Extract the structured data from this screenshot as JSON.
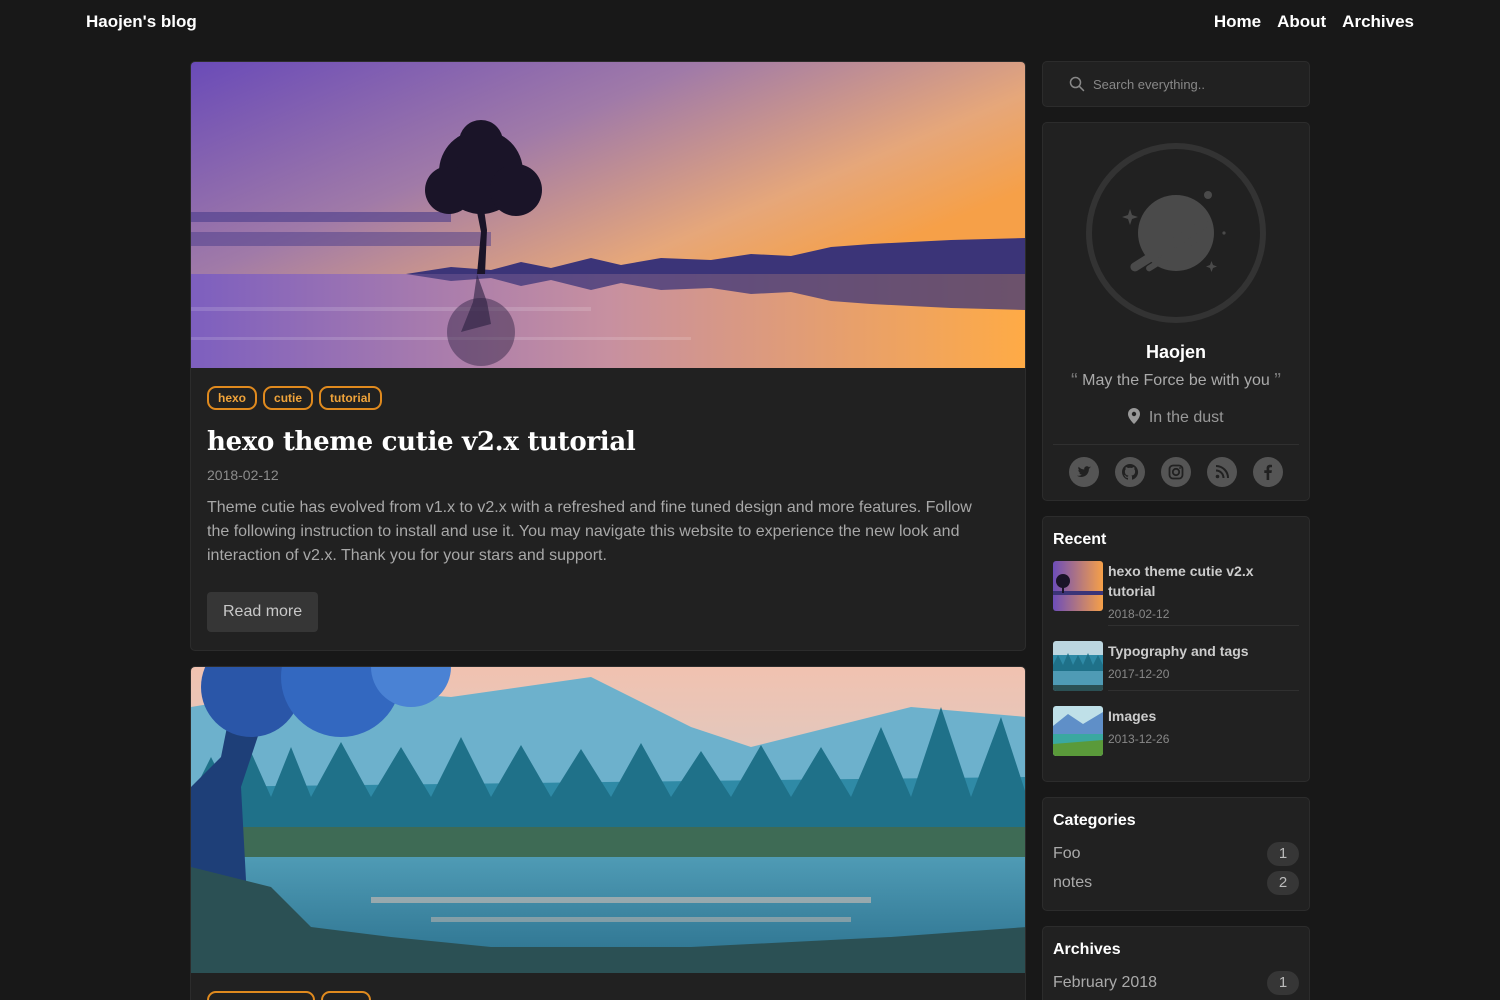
{
  "site": {
    "brand": "Haojen's blog",
    "nav": [
      {
        "label": "Home"
      },
      {
        "label": "About"
      },
      {
        "label": "Archives"
      }
    ]
  },
  "posts": [
    {
      "tags": [
        "hexo",
        "cutie",
        "tutorial"
      ],
      "title": "hexo theme cutie v2.x tutorial",
      "date": "2018-02-12",
      "excerpt": "Theme cutie has evolved from v1.x to v2.x with a refreshed and fine tuned design and more features. Follow the following instruction to install and use it. You may navigate this website to experience the new look and interaction of v2.x. Thank you for your stars and support.",
      "read_more": "Read more"
    }
  ],
  "sidebar": {
    "search_placeholder": "Search everything..",
    "profile": {
      "name": "Haojen",
      "motto": "May the Force be with you",
      "location": "In the dust",
      "socials": [
        "twitter-icon",
        "github-icon",
        "instagram-icon",
        "rss-icon",
        "facebook-icon"
      ]
    },
    "recent": {
      "title": "Recent",
      "items": [
        {
          "title": "hexo theme cutie v2.x tutorial",
          "date": "2018-02-12"
        },
        {
          "title": "Typography and tags",
          "date": "2017-12-20"
        },
        {
          "title": "Images",
          "date": "2013-12-26"
        }
      ]
    },
    "categories": {
      "title": "Categories",
      "items": [
        {
          "name": "Foo",
          "count": "1"
        },
        {
          "name": "notes",
          "count": "2"
        }
      ]
    },
    "archives": {
      "title": "Archives",
      "items": [
        {
          "name": "February 2018",
          "count": "1"
        }
      ]
    }
  },
  "colors": {
    "background": "#181818",
    "card": "#212121",
    "tag_accent": "#e08a1e"
  }
}
